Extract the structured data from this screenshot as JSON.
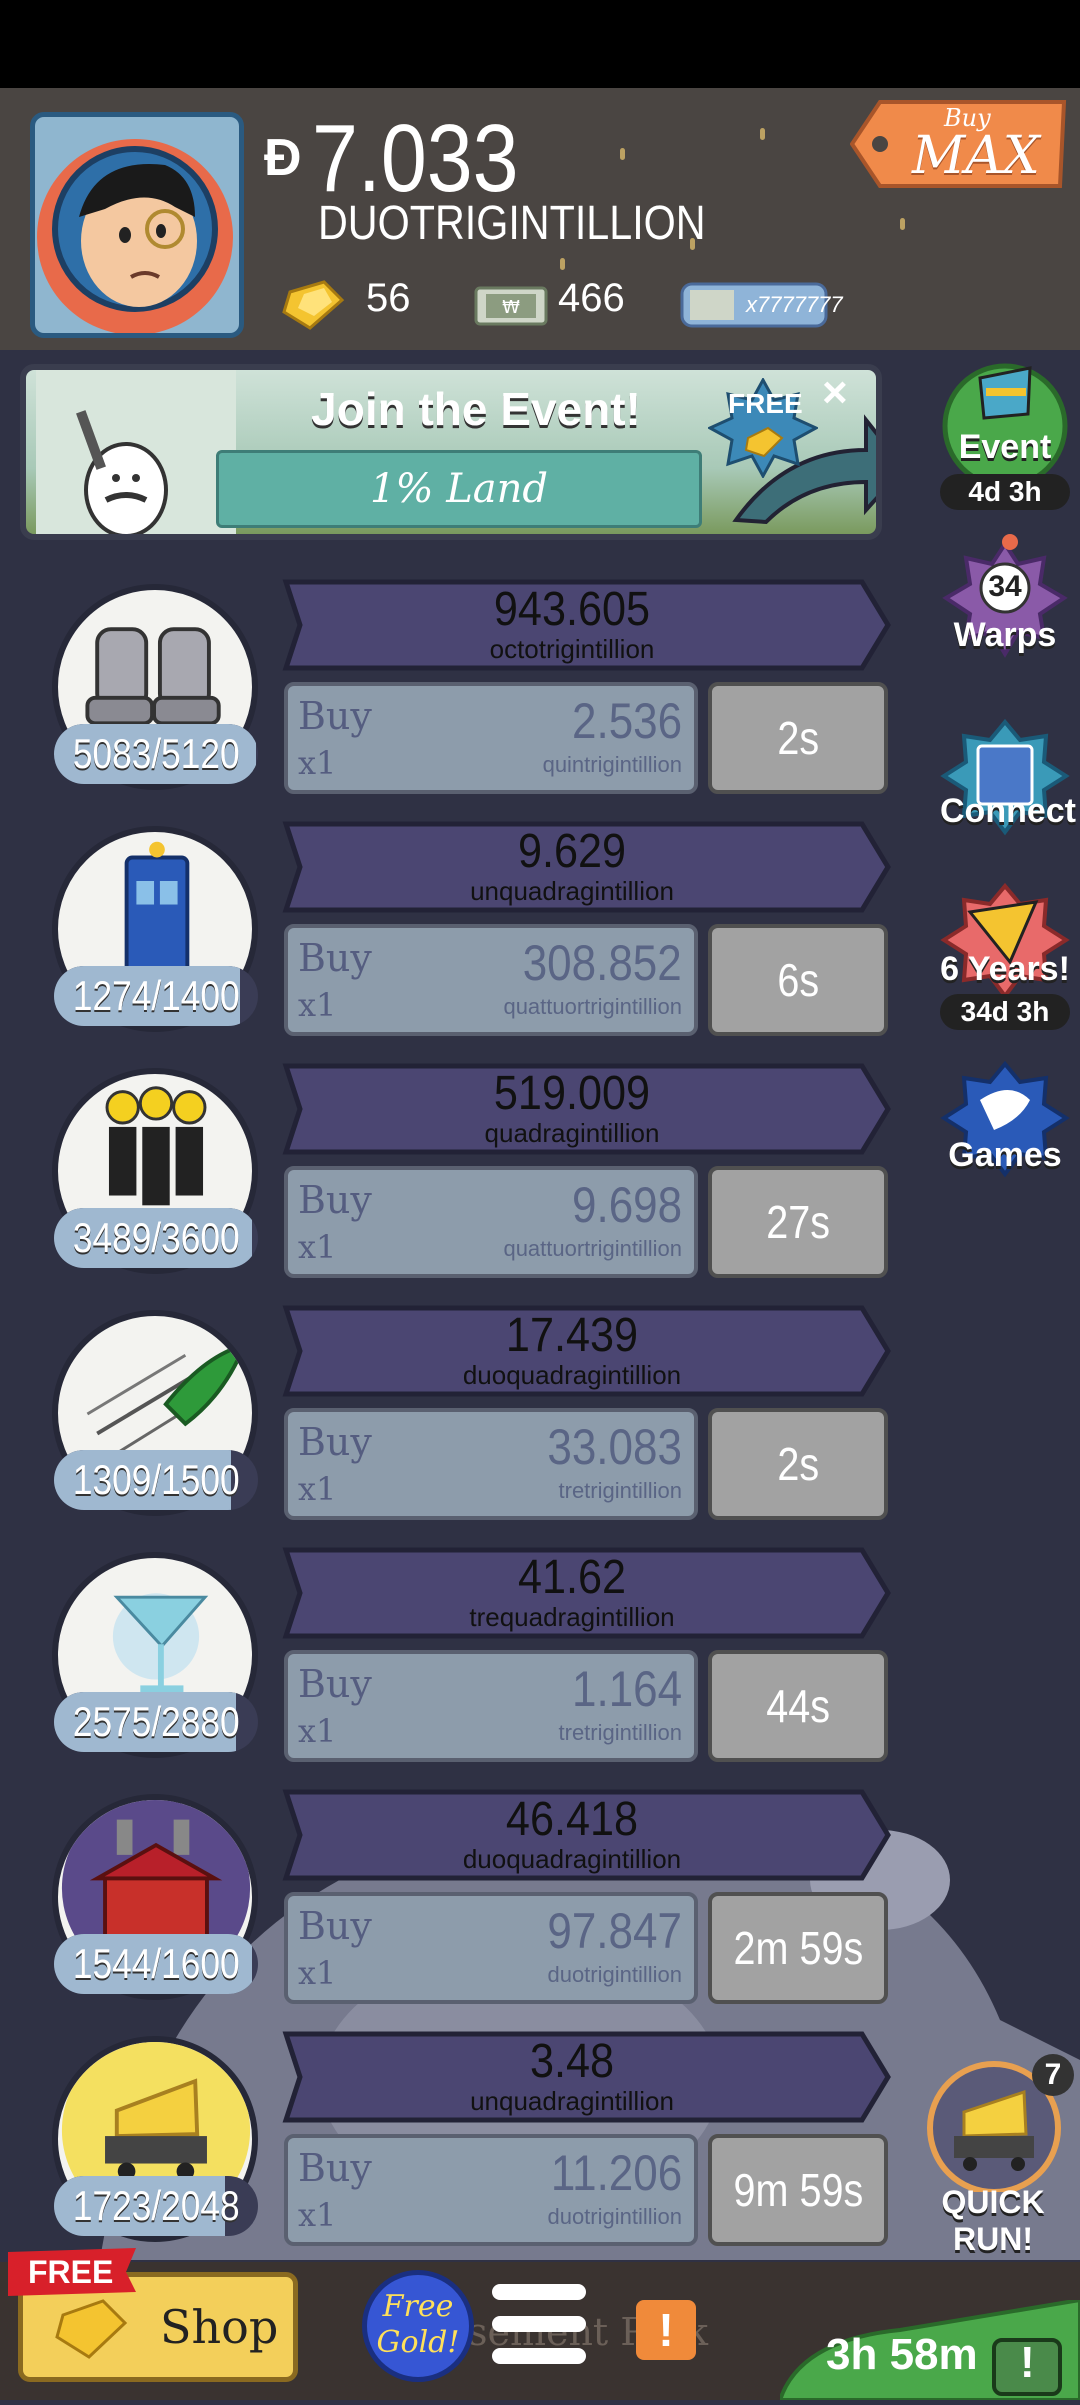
{
  "header": {
    "money_symbol": "Ð",
    "money_value": "7.033",
    "money_unit": "DUOTRIGINTILLION",
    "gold_count": "56",
    "megabucks_count": "466",
    "megaticket_label": "x7777777",
    "buy_small": "Buy",
    "buy_big": "MAX"
  },
  "event_banner": {
    "title": "Join the Event!",
    "subtitle": "1% Land",
    "free_label": "FREE",
    "close": "×"
  },
  "side_menu": {
    "event": {
      "label": "Event",
      "timer": "4d 3h"
    },
    "warps": {
      "label": "Warps",
      "count": "34"
    },
    "connect": {
      "label": "Connect"
    },
    "anniversary": {
      "label": "6 Years!",
      "timer": "34d 3h"
    },
    "games": {
      "label": "Games"
    }
  },
  "businesses": [
    {
      "icon": "moon-boots-icon",
      "count": "5083/5120",
      "progress": 0.993,
      "profit": "943.605",
      "profit_unit": "octotrigintillion",
      "buy": "Buy",
      "mult": "x1",
      "cost": "2.536",
      "cost_unit": "quintrigintillion",
      "time": "2s"
    },
    {
      "icon": "phone-booth-icon",
      "count": "1274/1400",
      "progress": 0.91,
      "profit": "9.629",
      "profit_unit": "unquadragintillion",
      "buy": "Buy",
      "mult": "x1",
      "cost": "308.852",
      "cost_unit": "quattuortrigintillion",
      "time": "6s"
    },
    {
      "icon": "smiley-podium-icon",
      "count": "3489/3600",
      "progress": 0.969,
      "profit": "519.009",
      "profit_unit": "quadragintillion",
      "buy": "Buy",
      "mult": "x1",
      "cost": "9.698",
      "cost_unit": "quattuortrigintillion",
      "time": "27s"
    },
    {
      "icon": "rocket-icon",
      "count": "1309/1500",
      "progress": 0.873,
      "profit": "17.439",
      "profit_unit": "duoquadragintillion",
      "buy": "Buy",
      "mult": "x1",
      "cost": "33.083",
      "cost_unit": "tretrigintillion",
      "time": "2s"
    },
    {
      "icon": "cocktail-glass-icon",
      "count": "2575/2880",
      "progress": 0.894,
      "profit": "41.62",
      "profit_unit": "trequadragintillion",
      "buy": "Buy",
      "mult": "x1",
      "cost": "1.164",
      "cost_unit": "tretrigintillion",
      "time": "44s"
    },
    {
      "icon": "red-barn-icon",
      "count": "1544/1600",
      "progress": 0.965,
      "profit": "46.418",
      "profit_unit": "duoquadragintillion",
      "buy": "Buy",
      "mult": "x1",
      "cost": "97.847",
      "cost_unit": "duotrigintillion",
      "time": "2m 59s"
    },
    {
      "icon": "cheese-cart-icon",
      "count": "1723/2048",
      "progress": 0.841,
      "profit": "3.48",
      "profit_unit": "unquadragintillion",
      "buy": "Buy",
      "mult": "x1",
      "cost": "11.206",
      "cost_unit": "duotrigintillion",
      "time": "9m 59s"
    }
  ],
  "quick_run": {
    "label": "QUICK RUN!",
    "badge": "7"
  },
  "bottom": {
    "free_tag": "FREE",
    "shop_label": "Shop",
    "free_gold_line1": "Free",
    "free_gold_line2": "Gold!",
    "park_text": "Amusement Park",
    "alert": "!",
    "timer": "3h 58m",
    "tv_alert": "!"
  },
  "colors": {
    "header_bg": "#4a4542",
    "profit_banner": "#4b4672",
    "buy_box": "#8d9cab",
    "time_box": "#a2a2a2",
    "side_green": "#4aa84a"
  }
}
